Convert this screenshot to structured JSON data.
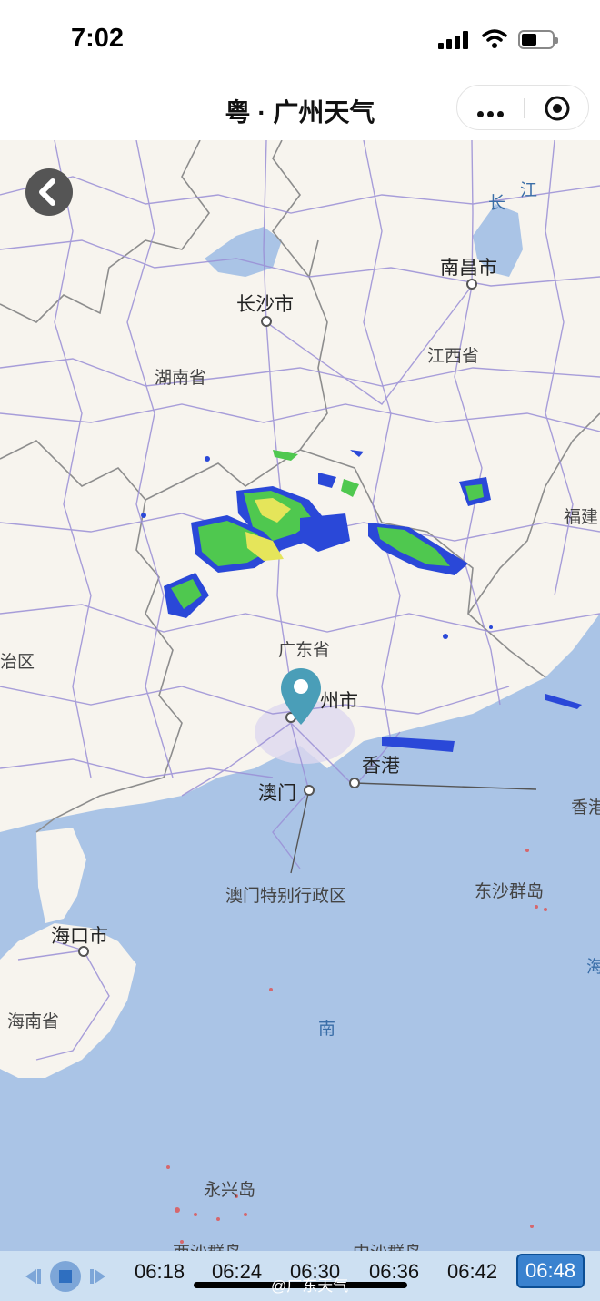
{
  "status": {
    "time": "7:02"
  },
  "nav": {
    "title": "粤 · 广州天气"
  },
  "map": {
    "places": {
      "changsha": "长沙市",
      "nanchang": "南昌市",
      "hunan": "湖南省",
      "jiangxi": "江西省",
      "fujian": "福建",
      "guangdong": "广东省",
      "guangzhou": "州市",
      "hongkong": "香港",
      "hongkong_edge": "香港",
      "macau": "澳门",
      "macau_sar": "澳门特别行政区",
      "dongsha": "东沙群岛",
      "haikou": "海口市",
      "hainan": "海南省",
      "south": "南",
      "yongxing": "永兴岛",
      "xisha": "西沙群岛",
      "zhongsha": "中沙群岛",
      "region_edge": "治区",
      "river_chang": "长",
      "river_jiang": "江",
      "sea_edge": "海"
    }
  },
  "timeline": {
    "times": [
      "06:18",
      "06:24",
      "06:30",
      "06:36",
      "06:42",
      "06:48"
    ],
    "active": "06:48"
  },
  "watermark": "@广东天气",
  "colors": {
    "sea": "#aac4e6",
    "land": "#f7f4ee",
    "road": "#9a8fd6",
    "radar_green": "#4fc84f",
    "radar_blue": "#2a48d8",
    "active_tab": "#3a82cf"
  }
}
